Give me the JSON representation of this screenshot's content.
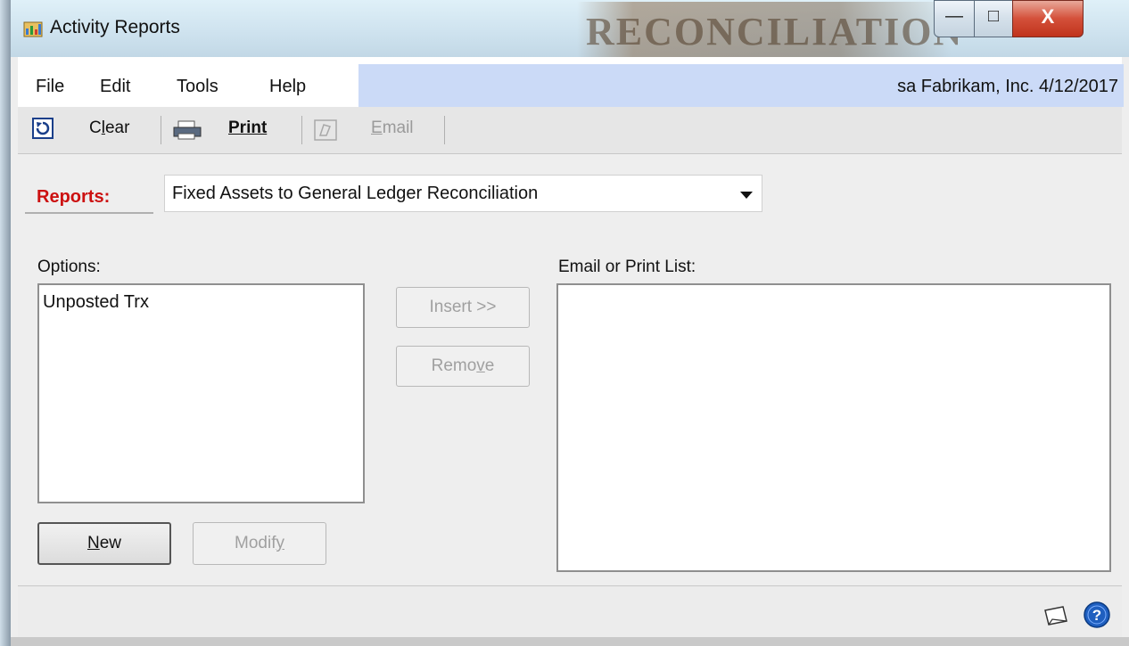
{
  "window": {
    "title": "Activity Reports",
    "watermark_text": "RECONCILIATION"
  },
  "window_controls": {
    "minimize": "—",
    "maximize": "□",
    "close": "X"
  },
  "menu": {
    "items": [
      "File",
      "Edit",
      "Tools",
      "Help"
    ]
  },
  "userinfo": "sa  Fabrikam, Inc.  4/12/2017",
  "toolbar": {
    "clear": "Clear",
    "print": "Print",
    "email": "Email"
  },
  "reports": {
    "label": "Reports:",
    "selected": "Fixed Assets to General Ledger Reconciliation"
  },
  "options": {
    "label": "Options:",
    "items": [
      "Unposted Trx"
    ]
  },
  "email_print_list": {
    "label": "Email or Print List:",
    "items": []
  },
  "buttons": {
    "insert": "Insert >>",
    "remove": "Remove",
    "new": "New",
    "modify": "Modify"
  },
  "colors": {
    "reports_label": "#cc1111",
    "menubar_highlight": "#cbdaf7",
    "help_icon": "#1f5fbf"
  }
}
